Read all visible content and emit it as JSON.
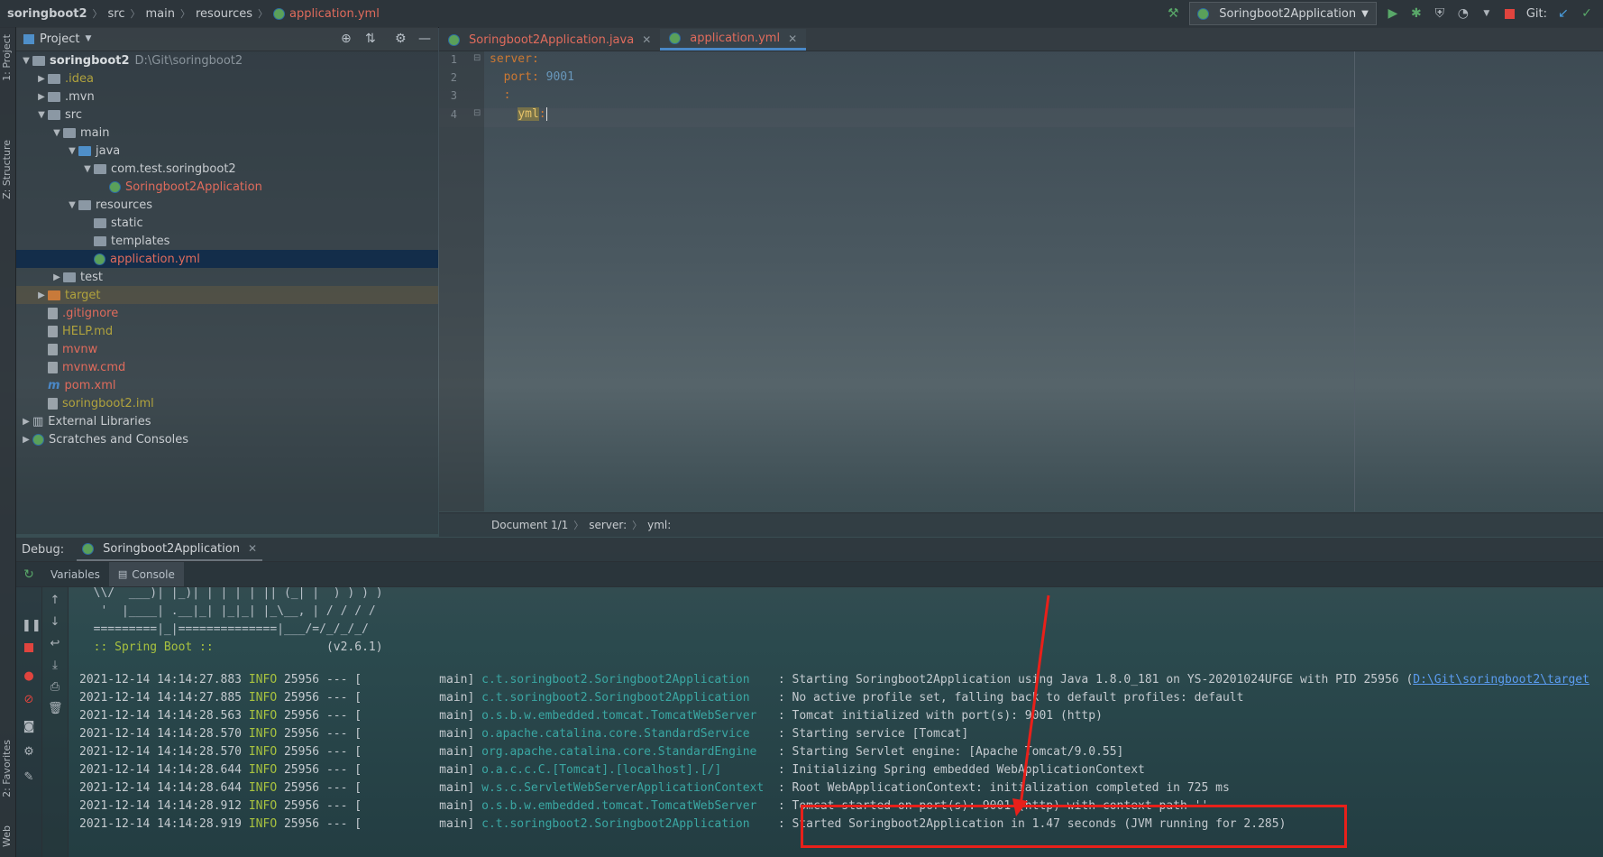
{
  "breadcrumb": [
    "soringboot2",
    "src",
    "main",
    "resources",
    "application.yml"
  ],
  "toolbar": {
    "run_config": "Soringboot2Application",
    "git_label": "Git:",
    "colors": {
      "run": "#59a869",
      "stop": "#e0443e",
      "debug": "#59a869"
    }
  },
  "side_tabs": {
    "project": "1: Project",
    "structure": "Z: Structure",
    "favorites": "2: Favorites",
    "web": "Web"
  },
  "project": {
    "title": "Project",
    "tree": [
      {
        "label": "soringboot2",
        "path_hint": "D:\\Git\\soringboot2",
        "indent": 0,
        "arrow": "▼",
        "icon": "folder",
        "color": "bold"
      },
      {
        "label": ".idea",
        "indent": 1,
        "arrow": "▶",
        "icon": "folder",
        "color": "olive"
      },
      {
        "label": ".mvn",
        "indent": 1,
        "arrow": "▶",
        "icon": "folder",
        "color": "default"
      },
      {
        "label": "src",
        "indent": 1,
        "arrow": "▼",
        "icon": "folder",
        "color": "default"
      },
      {
        "label": "main",
        "indent": 2,
        "arrow": "▼",
        "icon": "folder",
        "color": "default"
      },
      {
        "label": "java",
        "indent": 3,
        "arrow": "▼",
        "icon": "folder-blue",
        "color": "default"
      },
      {
        "label": "com.test.soringboot2",
        "indent": 4,
        "arrow": "▼",
        "icon": "package",
        "color": "default"
      },
      {
        "label": "Soringboot2Application",
        "indent": 5,
        "arrow": "",
        "icon": "spring",
        "color": "red"
      },
      {
        "label": "resources",
        "indent": 3,
        "arrow": "▼",
        "icon": "folder",
        "color": "default"
      },
      {
        "label": "static",
        "indent": 4,
        "arrow": "",
        "icon": "folder",
        "color": "default"
      },
      {
        "label": "templates",
        "indent": 4,
        "arrow": "",
        "icon": "folder",
        "color": "default"
      },
      {
        "label": "application.yml",
        "indent": 4,
        "arrow": "",
        "icon": "spring",
        "color": "red",
        "selected": true
      },
      {
        "label": "test",
        "indent": 2,
        "arrow": "▶",
        "icon": "folder",
        "color": "default"
      },
      {
        "label": "target",
        "indent": 1,
        "arrow": "▶",
        "icon": "folder-orange",
        "color": "olive",
        "highlight": true
      },
      {
        "label": ".gitignore",
        "indent": 1,
        "arrow": "",
        "icon": "file",
        "color": "red"
      },
      {
        "label": "HELP.md",
        "indent": 1,
        "arrow": "",
        "icon": "file",
        "color": "olive"
      },
      {
        "label": "mvnw",
        "indent": 1,
        "arrow": "",
        "icon": "file",
        "color": "red"
      },
      {
        "label": "mvnw.cmd",
        "indent": 1,
        "arrow": "",
        "icon": "file",
        "color": "red"
      },
      {
        "label": "pom.xml",
        "indent": 1,
        "arrow": "",
        "icon": "maven",
        "color": "red"
      },
      {
        "label": "soringboot2.iml",
        "indent": 1,
        "arrow": "",
        "icon": "file",
        "color": "olive"
      },
      {
        "label": "External Libraries",
        "indent": 0,
        "arrow": "▶",
        "icon": "libs",
        "color": "default"
      },
      {
        "label": "Scratches and Consoles",
        "indent": 0,
        "arrow": "▶",
        "icon": "scratch",
        "color": "default"
      }
    ]
  },
  "editor": {
    "tabs": [
      {
        "label": "Soringboot2Application.java",
        "active": false
      },
      {
        "label": "application.yml",
        "active": true
      }
    ],
    "line_numbers": [
      "1",
      "2",
      "3",
      "4"
    ],
    "lines": {
      "l1": "server:",
      "l2_key": "port:",
      "l2_val": "9001",
      "l3": ":",
      "l4_key": "yml",
      "l4_colon": ":"
    },
    "status_breadcrumb": [
      "Document 1/1",
      "server:",
      "yml:"
    ]
  },
  "debug": {
    "label": "Debug:",
    "session": "Soringboot2Application",
    "subtabs": [
      "Variables",
      "Console"
    ],
    "banner": [
      "  \\\\/  ___)| |_)| | | | | || (_| |  ) ) ) )",
      "   '  |____| .__|_| |_|_| |_\\__, | / / / /",
      "  =========|_|==============|___/=/_/_/_/"
    ],
    "spring_label": "  :: Spring Boot ::",
    "spring_version": "(v2.6.1)",
    "logs": [
      {
        "ts": "2021-12-14 14:14:27.883",
        "level": "INFO",
        "pid": "25956 --- [",
        "thread": "          main]",
        "logger": "c.t.soringboot2.Soringboot2Application  ",
        "msg": " : Starting Soringboot2Application using Java 1.8.0_181 on YS-20201024UFGE with PID 25956 (",
        "link": "D:\\Git\\soringboot2\\target"
      },
      {
        "ts": "2021-12-14 14:14:27.885",
        "level": "INFO",
        "pid": "25956 --- [",
        "thread": "          main]",
        "logger": "c.t.soringboot2.Soringboot2Application  ",
        "msg": " : No active profile set, falling back to default profiles: default"
      },
      {
        "ts": "2021-12-14 14:14:28.563",
        "level": "INFO",
        "pid": "25956 --- [",
        "thread": "          main]",
        "logger": "o.s.b.w.embedded.tomcat.TomcatWebServer ",
        "msg": " : Tomcat initialized with port(s): 9001 (http)"
      },
      {
        "ts": "2021-12-14 14:14:28.570",
        "level": "INFO",
        "pid": "25956 --- [",
        "thread": "          main]",
        "logger": "o.apache.catalina.core.StandardService  ",
        "msg": " : Starting service [Tomcat]"
      },
      {
        "ts": "2021-12-14 14:14:28.570",
        "level": "INFO",
        "pid": "25956 --- [",
        "thread": "          main]",
        "logger": "org.apache.catalina.core.StandardEngine ",
        "msg": " : Starting Servlet engine: [Apache Tomcat/9.0.55]"
      },
      {
        "ts": "2021-12-14 14:14:28.644",
        "level": "INFO",
        "pid": "25956 --- [",
        "thread": "          main]",
        "logger": "o.a.c.c.C.[Tomcat].[localhost].[/]      ",
        "msg": " : Initializing Spring embedded WebApplicationContext"
      },
      {
        "ts": "2021-12-14 14:14:28.644",
        "level": "INFO",
        "pid": "25956 --- [",
        "thread": "          main]",
        "logger": "w.s.c.ServletWebServerApplicationContext",
        "msg": " : Root WebApplicationContext: initialization completed in 725 ms"
      },
      {
        "ts": "2021-12-14 14:14:28.912",
        "level": "INFO",
        "pid": "25956 --- [",
        "thread": "          main]",
        "logger": "o.s.b.w.embedded.tomcat.TomcatWebServer ",
        "msg": " : Tomcat started on port(s): 9001 (http) with context path ''"
      },
      {
        "ts": "2021-12-14 14:14:28.919",
        "level": "INFO",
        "pid": "25956 --- [",
        "thread": "          main]",
        "logger": "c.t.soringboot2.Soringboot2Application  ",
        "msg": " : Started Soringboot2Application in 1.47 seconds (JVM running for 2.285)"
      }
    ]
  },
  "annotation": {
    "color": "#e8201a"
  }
}
